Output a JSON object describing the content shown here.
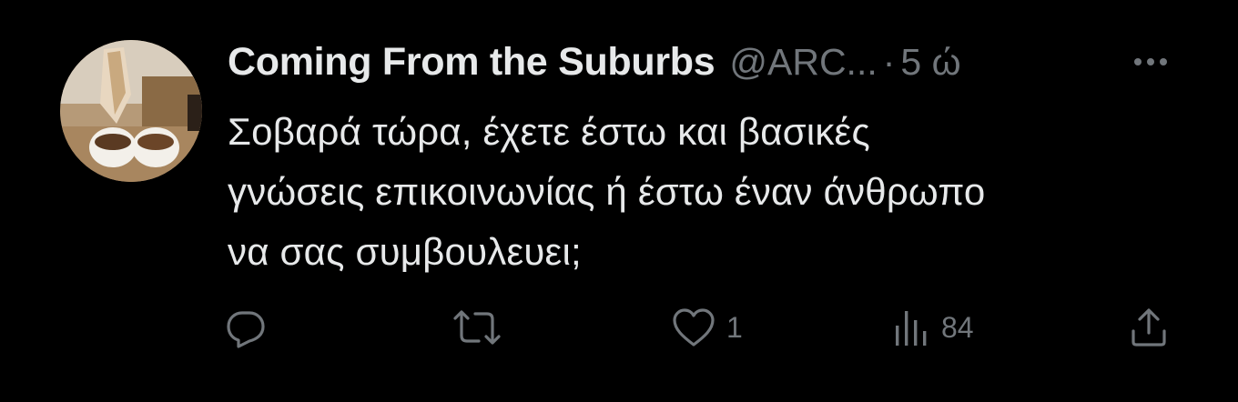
{
  "tweet": {
    "display_name": "Coming From the Suburbs",
    "handle": "@ARC...",
    "separator": "·",
    "time": "5 ώ",
    "text": "Σοβαρά τώρα, έχετε έστω και βασικές\nγνώσεις επικοινωνίας ή έστω έναν άνθρωπο\nνα σας συμβουλευει;"
  },
  "actions": {
    "reply": {
      "icon": "reply-icon",
      "count": ""
    },
    "retweet": {
      "icon": "retweet-icon",
      "count": ""
    },
    "like": {
      "icon": "heart-icon",
      "count": "1"
    },
    "views": {
      "icon": "views-icon",
      "count": "84"
    },
    "share": {
      "icon": "share-icon",
      "count": ""
    }
  },
  "colors": {
    "background": "#000000",
    "primary_text": "#e7e9ea",
    "secondary_text": "#71767b"
  }
}
